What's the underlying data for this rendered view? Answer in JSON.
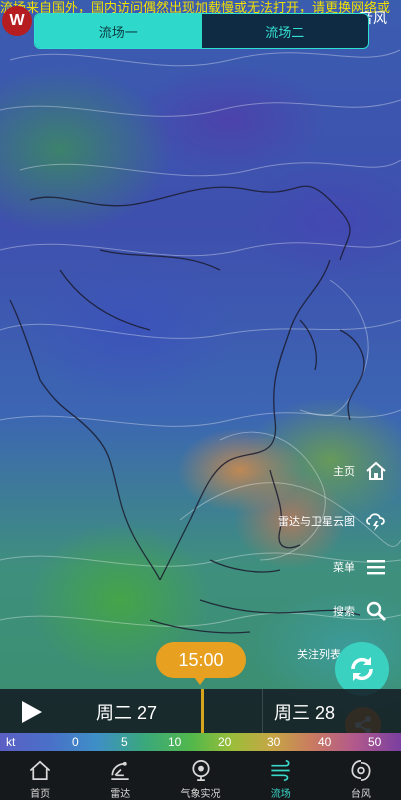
{
  "banner_text": "流场来自国外，国内访问偶然出现加载慢或无法打开，请更换网络或",
  "logo": {
    "mark": "W",
    "text": "Wi"
  },
  "brand_right": "音风",
  "tabs": [
    {
      "label": "流场一",
      "active": true
    },
    {
      "label": "流场二",
      "active": false
    }
  ],
  "side_menu": [
    {
      "label": "主页",
      "icon": "home-icon"
    },
    {
      "label": "雷达与卫星云图",
      "icon": "cloud-lightning-icon"
    },
    {
      "label": "菜单",
      "icon": "hamburger-icon"
    },
    {
      "label": "搜索",
      "icon": "search-icon"
    },
    {
      "label": "关注列表",
      "icon": "star-icon"
    }
  ],
  "time_bubble": "15:00",
  "timeline": {
    "day1": "周二 27",
    "day2": "周三 28"
  },
  "scale": {
    "unit": "kt",
    "ticks": [
      "0",
      "5",
      "10",
      "20",
      "30",
      "40",
      "50"
    ]
  },
  "nav": [
    {
      "label": "首页",
      "icon": "home-icon",
      "active": false
    },
    {
      "label": "雷达",
      "icon": "radar-icon",
      "active": false
    },
    {
      "label": "气象实况",
      "icon": "weather-live-icon",
      "active": false
    },
    {
      "label": "流场",
      "icon": "wind-flow-icon",
      "active": true
    },
    {
      "label": "台风",
      "icon": "typhoon-icon",
      "active": false
    }
  ],
  "colors": {
    "accent": "#2ed8cb",
    "time_bubble": "#e7a01f",
    "share": "#ff9b1a",
    "banner": "#f2e000"
  }
}
